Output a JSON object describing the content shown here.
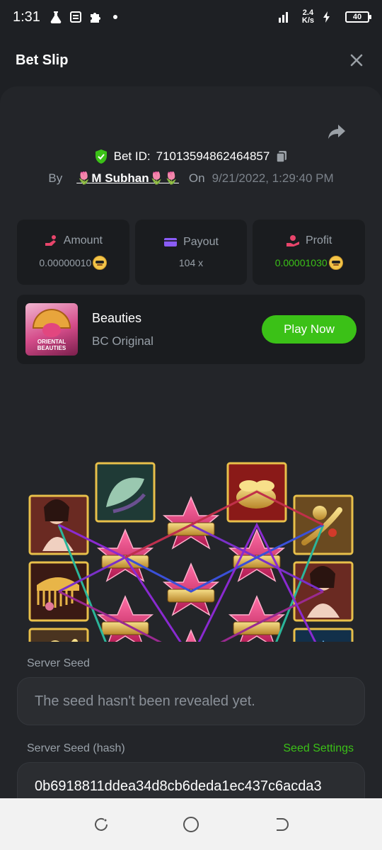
{
  "status_bar": {
    "time": "1:31",
    "net_speed": "2.4",
    "net_unit": "K/s",
    "battery": "40"
  },
  "header": {
    "title": "Bet Slip"
  },
  "bet": {
    "id_label": "Bet ID:",
    "id_value": "71013594862464857",
    "by_label": "By",
    "username": "🌷M Subhan🌷🌷",
    "on_label": "On",
    "date": "9/21/2022, 1:29:40 PM"
  },
  "stats": {
    "amount_label": "Amount",
    "amount_value": "0.00000010",
    "payout_label": "Payout",
    "payout_value": "104 x",
    "profit_label": "Profit",
    "profit_value": "0.00001030"
  },
  "game": {
    "thumb_text": "ORIENTAL BEAUTIES",
    "name": "Beauties",
    "provider": "BC Original",
    "play_label": "Play Now"
  },
  "reels": {
    "wild_label": "WILD"
  },
  "seeds": {
    "server_seed_label": "Server Seed",
    "server_seed_value": "The seed hasn't been revealed yet.",
    "server_seed_hash_label": "Server Seed (hash)",
    "seed_settings_label": "Seed Settings",
    "server_seed_hash_value": "0b6918811ddea34d8cb6deda1ec437c6acda3"
  },
  "colors": {
    "accent_green": "#3bc117",
    "panel_bg": "#232529",
    "page_bg": "#1e2024"
  }
}
